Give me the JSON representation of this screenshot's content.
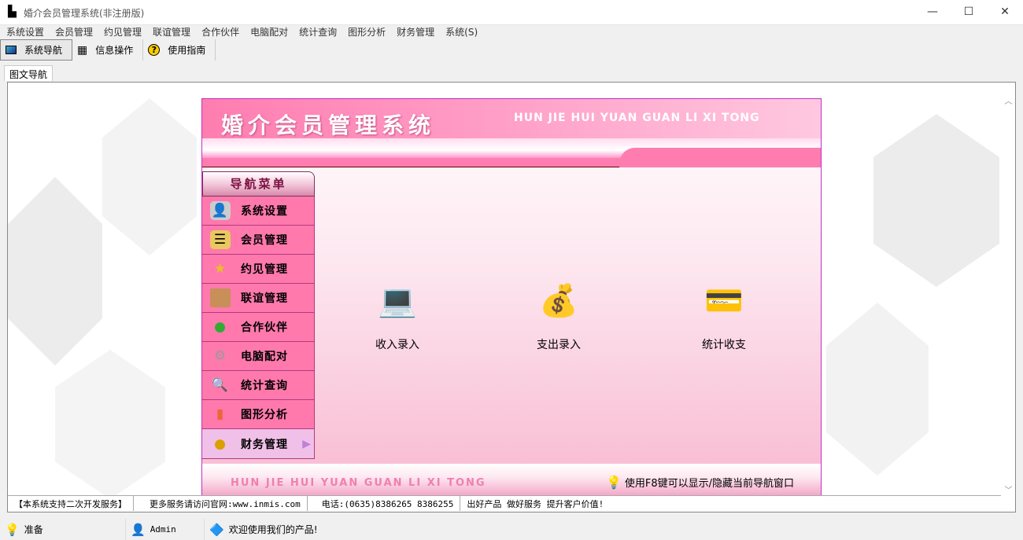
{
  "window": {
    "title": "婚介会员管理系统(非注册版)",
    "minimize": "—",
    "maximize": "☐",
    "close": "✕"
  },
  "menu": [
    "系统设置",
    "会员管理",
    "约见管理",
    "联谊管理",
    "合作伙伴",
    "电脑配对",
    "统计查询",
    "图形分析",
    "财务管理",
    "系统(S)"
  ],
  "toolbar": [
    {
      "label": "系统导航",
      "icon": "monitor-icon"
    },
    {
      "label": "信息操作",
      "icon": "grid-icon"
    },
    {
      "label": "使用指南",
      "icon": "help-icon"
    }
  ],
  "tab": "图文导航",
  "header": {
    "title": "婚介会员管理系统",
    "subtitle": "HUN JIE HUI YUAN GUAN LI XI TONG"
  },
  "nav": {
    "title": "导航菜单",
    "items": [
      {
        "label": "系统设置",
        "icon": "id-card-icon"
      },
      {
        "label": "会员管理",
        "icon": "scroll-icon"
      },
      {
        "label": "约见管理",
        "icon": "star-icon"
      },
      {
        "label": "联谊管理",
        "icon": "crate-icon"
      },
      {
        "label": "合作伙伴",
        "icon": "users-icon"
      },
      {
        "label": "电脑配对",
        "icon": "gear-icon"
      },
      {
        "label": "统计查询",
        "icon": "magnifier-icon"
      },
      {
        "label": "图形分析",
        "icon": "bar-chart-icon"
      },
      {
        "label": "财务管理",
        "icon": "coins-icon"
      }
    ],
    "selected": "财务管理"
  },
  "functions": [
    {
      "label": "收入录入",
      "icon": "laptop-coins-icon"
    },
    {
      "label": "支出录入",
      "icon": "money-bag-icon"
    },
    {
      "label": "统计收支",
      "icon": "card-coins-icon"
    }
  ],
  "footer": {
    "subtitle": "HUN JIE HUI YUAN GUAN LI XI TONG",
    "hint": "使用F8键可以显示/隐藏当前导航窗口"
  },
  "info": [
    "【本系统支持二次开发服务】",
    "更多服务请访问官网:www.inmis.com",
    "电话:(0635)8386265 8386255",
    "出好产品 做好服务 提升客户价值!"
  ],
  "status": {
    "state": "准备",
    "user": "Admin",
    "welcome": "欢迎使用我们的产品!"
  },
  "colors": {
    "pink": "#ff79ad",
    "selected": "#f0c0e8",
    "border": "#c030c0"
  }
}
